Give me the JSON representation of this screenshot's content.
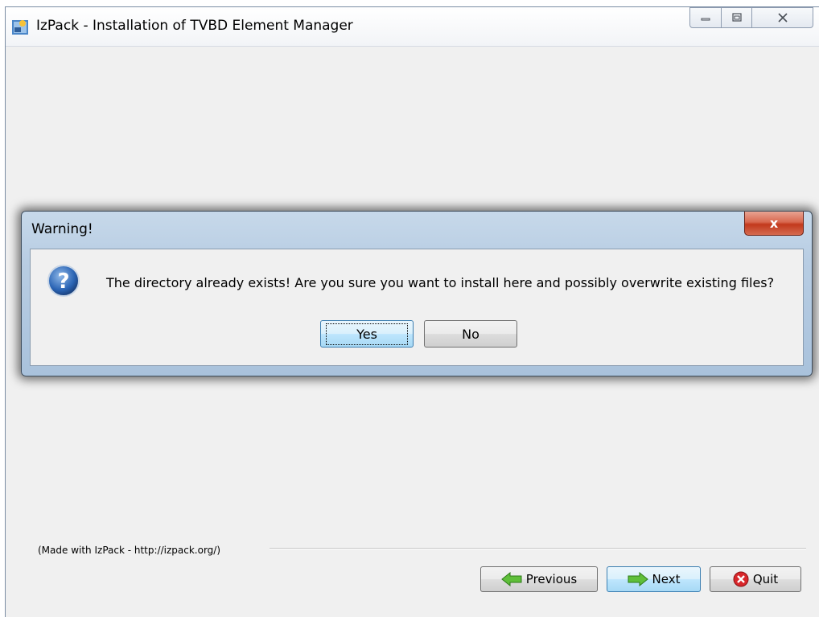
{
  "window": {
    "title": "IzPack - Installation of TVBD Element Manager",
    "icon": "izpack-installer-icon"
  },
  "footer": {
    "made_with": "(Made with IzPack - http://izpack.org/)"
  },
  "nav_buttons": {
    "previous": "Previous",
    "next": "Next",
    "quit": "Quit"
  },
  "dialog": {
    "title": "Warning!",
    "message": "The directory already exists! Are you sure you want to install here and possibly overwrite existing files?",
    "icon": "question-icon",
    "yes_label": "Yes",
    "no_label": "No",
    "close_glyph": "x"
  },
  "colors": {
    "dialog_frame": "#b8cde3",
    "close_red": "#c2391c",
    "hot_button": "#bee6fd"
  }
}
